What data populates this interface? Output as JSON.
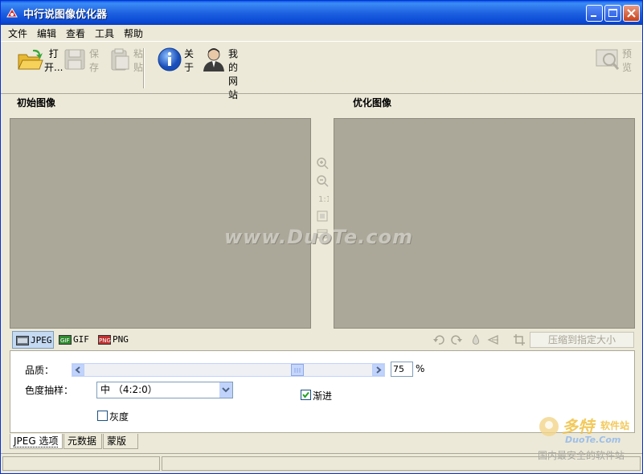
{
  "window": {
    "title": "中行说图像优化器"
  },
  "menu": [
    "文件",
    "编辑",
    "查看",
    "工具",
    "帮助"
  ],
  "toolbar": {
    "open": "打开...",
    "save": "保存",
    "paste": "粘贴",
    "about": "关于",
    "website": "我的网站",
    "preview": "预览"
  },
  "panels": {
    "original": "初始图像",
    "optimized": "优化图像"
  },
  "watermark": "www.DuoTe.com",
  "formats": [
    {
      "label": "JPEG",
      "active": true
    },
    {
      "label": "GIF"
    },
    {
      "label": "PNG"
    }
  ],
  "compress_button": "压缩到指定大小",
  "options": {
    "quality_label": "品质：",
    "quality_value": "75",
    "quality_unit": "%",
    "quality_slider_fraction": 0.75,
    "subsampling_label": "色度抽样：",
    "subsampling_value": "中 （4:2:0）",
    "progressive_label": "渐进",
    "progressive_checked": true,
    "grayscale_label": "灰度",
    "grayscale_checked": false
  },
  "bottom_tabs": [
    "JPEG 选项",
    "元数据",
    "蒙版"
  ],
  "logo_watermark": {
    "main": "多特",
    "sub": "软件站",
    "url": "DuoTe.Com",
    "tagline": "国内最安全的软件站"
  },
  "colors": {
    "titlebar": "#0A58E4",
    "image_bg": "#ACA899",
    "window_bg": "#ECE9D8"
  }
}
